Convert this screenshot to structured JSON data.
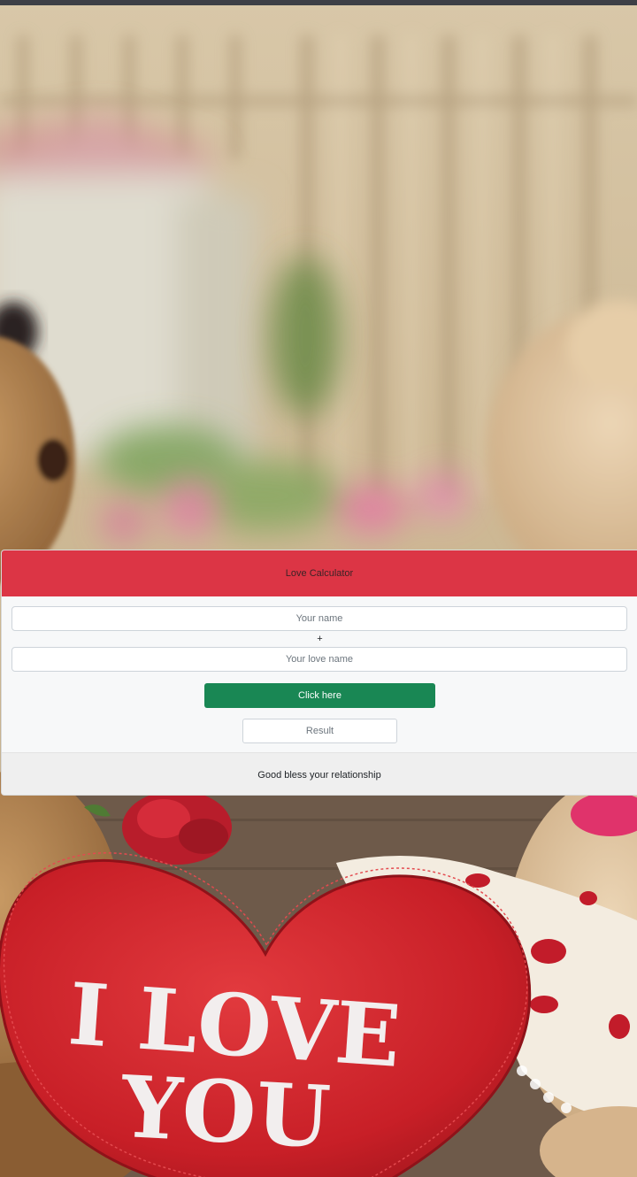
{
  "background": {
    "heart_text_line1": "I LOVE",
    "heart_text_line2": "YOU"
  },
  "card": {
    "title": "Love Calculator",
    "name_placeholder": "Your name",
    "plus": "+",
    "love_placeholder": "Your love name",
    "button_label": "Click here",
    "result_placeholder": "Result",
    "footer_text": "Good bless your relationship"
  },
  "colors": {
    "header": "#dc3545",
    "button": "#198754",
    "topbar": "#3d3f46"
  }
}
